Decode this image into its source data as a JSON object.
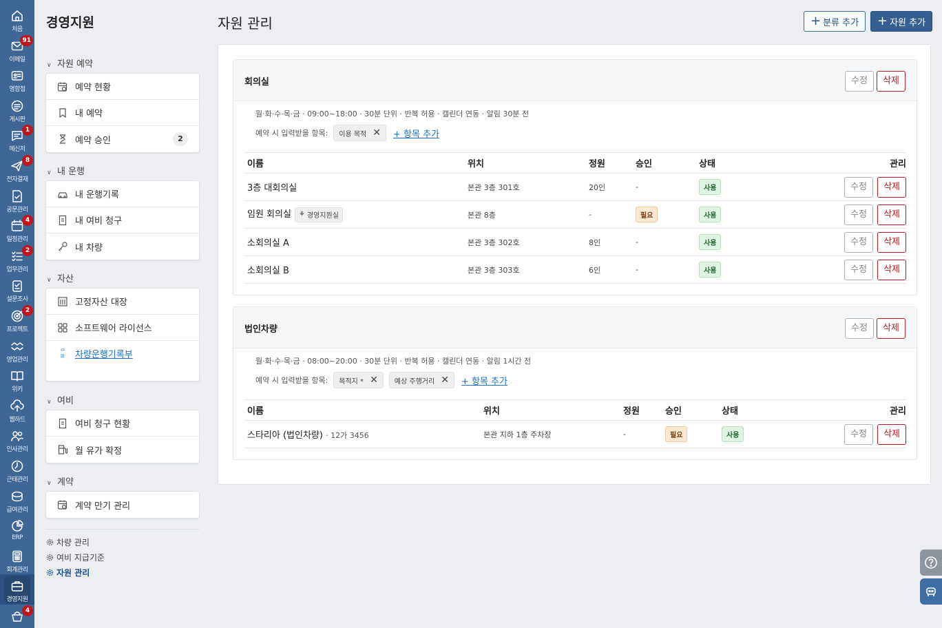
{
  "rail": [
    {
      "key": "home",
      "label": "처음",
      "badge": ""
    },
    {
      "key": "mail",
      "label": "이메일",
      "badge": "91"
    },
    {
      "key": "card",
      "label": "명함첩",
      "badge": ""
    },
    {
      "key": "board",
      "label": "게시판",
      "badge": ""
    },
    {
      "key": "msg",
      "label": "메신저",
      "badge": "1"
    },
    {
      "key": "approval",
      "label": "전자결재",
      "badge": "8"
    },
    {
      "key": "docs",
      "label": "공문관리",
      "badge": ""
    },
    {
      "key": "calendar",
      "label": "일정관리",
      "badge": "4"
    },
    {
      "key": "tasks",
      "label": "업무관리",
      "badge": "2"
    },
    {
      "key": "survey",
      "label": "설문조사",
      "badge": ""
    },
    {
      "key": "project",
      "label": "프로젝트",
      "badge": "2"
    },
    {
      "key": "sales",
      "label": "영업관리",
      "badge": ""
    },
    {
      "key": "wiki",
      "label": "위키",
      "badge": ""
    },
    {
      "key": "webhard",
      "label": "웹하드",
      "badge": ""
    },
    {
      "key": "hr",
      "label": "인사관리",
      "badge": ""
    },
    {
      "key": "attendance",
      "label": "근태관리",
      "badge": ""
    },
    {
      "key": "payroll",
      "label": "급여관리",
      "badge": ""
    },
    {
      "key": "erp",
      "label": "ERP",
      "badge": ""
    },
    {
      "key": "account",
      "label": "회계관리",
      "badge": ""
    },
    {
      "key": "biz",
      "label": "경영지원",
      "badge": ""
    },
    {
      "key": "more",
      "label": "",
      "badge": "4"
    }
  ],
  "sidebar": {
    "title": "경영지원",
    "sections": [
      {
        "label": "자원 예약",
        "items": [
          {
            "label": "예약 현황",
            "icon": "calendar-clock-icon"
          },
          {
            "label": "내 예약",
            "icon": "bookmark-icon"
          },
          {
            "label": "예약 승인",
            "icon": "hourglass-icon",
            "count": "2"
          }
        ]
      },
      {
        "label": "내 운행",
        "items": [
          {
            "label": "내 운행기록",
            "icon": "car-icon"
          },
          {
            "label": "내 여비 청구",
            "icon": "receipt-icon"
          },
          {
            "label": "내 차량",
            "icon": "key-icon"
          }
        ]
      },
      {
        "label": "자산",
        "items": [
          {
            "label": "고정자산 대장",
            "icon": "building-icon"
          },
          {
            "label": "소프트웨어 라이선스",
            "icon": "grid-icon"
          },
          {
            "label": "차량운행기록부",
            "icon": "car-log-icon",
            "link": true
          }
        ]
      },
      {
        "label": "여비",
        "items": [
          {
            "label": "여비 청구 현황",
            "icon": "receipt-icon"
          },
          {
            "label": "월 유가 확정",
            "icon": "fuel-icon"
          }
        ]
      },
      {
        "label": "계약",
        "items": [
          {
            "label": "계약 만기 관리",
            "icon": "calendar-clock-icon"
          }
        ]
      }
    ],
    "footer": [
      {
        "label": "차량 관리"
      },
      {
        "label": "여비 지급기준"
      },
      {
        "label": "자원 관리"
      }
    ]
  },
  "main": {
    "title": "자원 관리",
    "add_category": "분류 추가",
    "add_resource": "자원 추가",
    "edit_label": "수정",
    "delete_label": "삭제",
    "add_field": "+ 항목 추가",
    "field_prompt": "예약 시 입력받을 항목:",
    "headers": {
      "name": "이름",
      "location": "위치",
      "capacity": "정원",
      "approval": "승인",
      "status": "상태",
      "manage": "관리"
    },
    "groups": [
      {
        "title": "회의실",
        "meta": "월·화·수·목·금 · 09:00~18:00 · 30분 단위 · 반복 허용 · 캘린더 연동 · 알림 30분 전",
        "fields": [
          "이용 목적"
        ],
        "rows": [
          {
            "name": "3층 대회의실",
            "tag": "",
            "note": "",
            "location": "본관 3층 301호",
            "capacity": "20인",
            "approval": "-",
            "status": "사용"
          },
          {
            "name": "임원 회의실",
            "tag": "경영지원실",
            "note": "",
            "location": "본관 8층",
            "capacity": "-",
            "approval": "필요",
            "status": "사용"
          },
          {
            "name": "소회의실 A",
            "tag": "",
            "note": "",
            "location": "본관 3층 302호",
            "capacity": "8인",
            "approval": "-",
            "status": "사용"
          },
          {
            "name": "소회의실 B",
            "tag": "",
            "note": "",
            "location": "본관 3층 303호",
            "capacity": "6인",
            "approval": "-",
            "status": "사용"
          }
        ]
      },
      {
        "title": "법인차량",
        "meta": "월·화·수·목·금 · 08:00~20:00 · 30분 단위 · 반복 허용 · 캘린더 연동 · 알림 1시간 전",
        "fields": [
          "목적지 *",
          "예상 주행거리"
        ],
        "rows": [
          {
            "name": "스타리아 (법인차량)",
            "tag": "",
            "note": "· 12가 3456",
            "location": "본관 지하 1층 주차장",
            "capacity": "-",
            "approval": "필요",
            "status": "사용"
          }
        ]
      }
    ]
  }
}
